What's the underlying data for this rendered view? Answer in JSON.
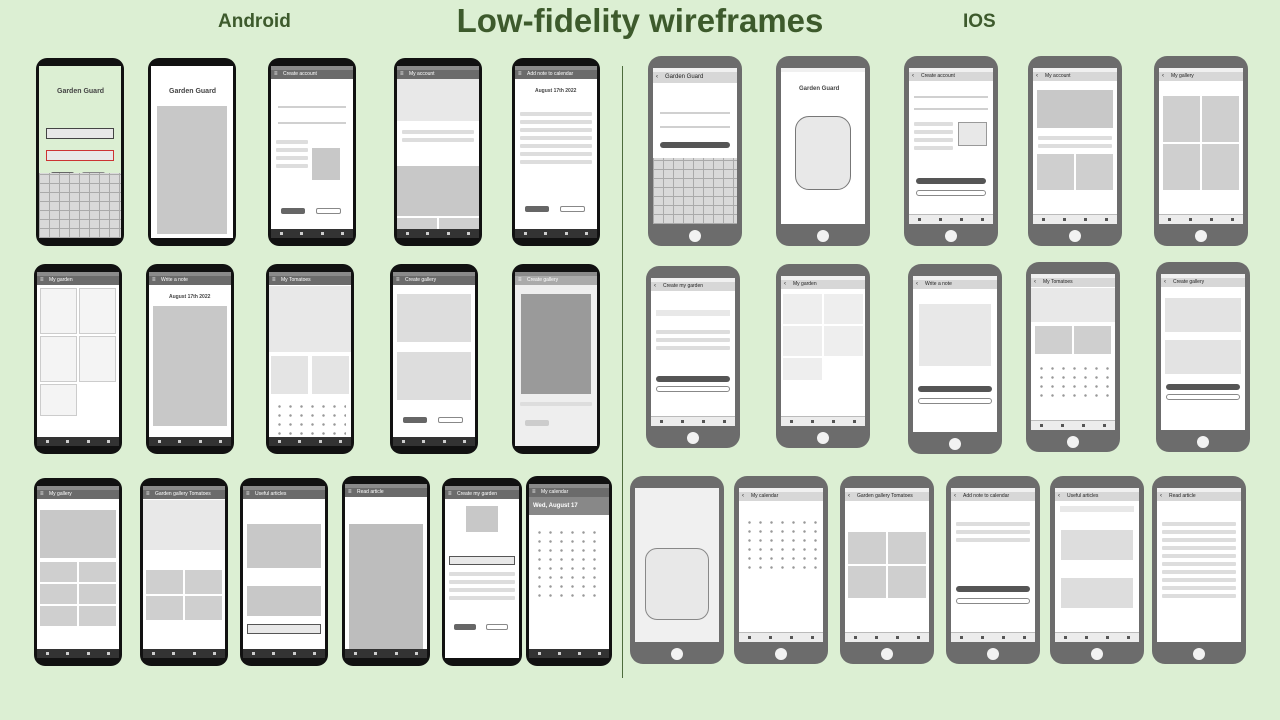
{
  "title": "Low-fidelity wireframes",
  "platform_labels": {
    "android": "Android",
    "ios": "IOS"
  },
  "android_screens": {
    "login_title": "Garden Guard",
    "splash_title": "Garden Guard",
    "create_account_header": "Create account",
    "my_account_header": "My account",
    "add_note_header": "Add note to calendar",
    "add_note_date": "August 17th 2022",
    "my_garden_header": "My garden",
    "write_note_header": "Write a note",
    "write_note_date": "August 17th 2022",
    "my_tomatoes_header": "My Tomatoes",
    "create_gallery_header": "Create gallery",
    "create_gallery2_header": "Create gallery",
    "my_gallery_header": "My gallery",
    "gallery_tomatoes_header": "Garden gallery Tomatoes",
    "useful_articles_header": "Useful articles",
    "read_article_header": "Read article",
    "create_garden_header": "Create my garden",
    "my_calendar_header": "My calendar",
    "calendar_date": "Wed, August 17"
  },
  "ios_screens": {
    "login_title": "Garden Guard",
    "splash_title": "Garden Guard",
    "create_account_header": "Create account",
    "my_account_header": "My account",
    "my_gallery_header": "My gallery",
    "create_garden_header": "Create my garden",
    "my_garden_header": "My garden",
    "write_note_header": "Write a note",
    "my_tomatoes_header": "My Tomatoes",
    "create_gallery_header": "Create gallery",
    "my_calendar_header": "My calendar",
    "gallery_tomatoes_header": "Garden gallery Tomatoes",
    "add_note_header": "Add note to calendar",
    "useful_articles_header": "Useful articles",
    "read_article_header": "Read article"
  }
}
